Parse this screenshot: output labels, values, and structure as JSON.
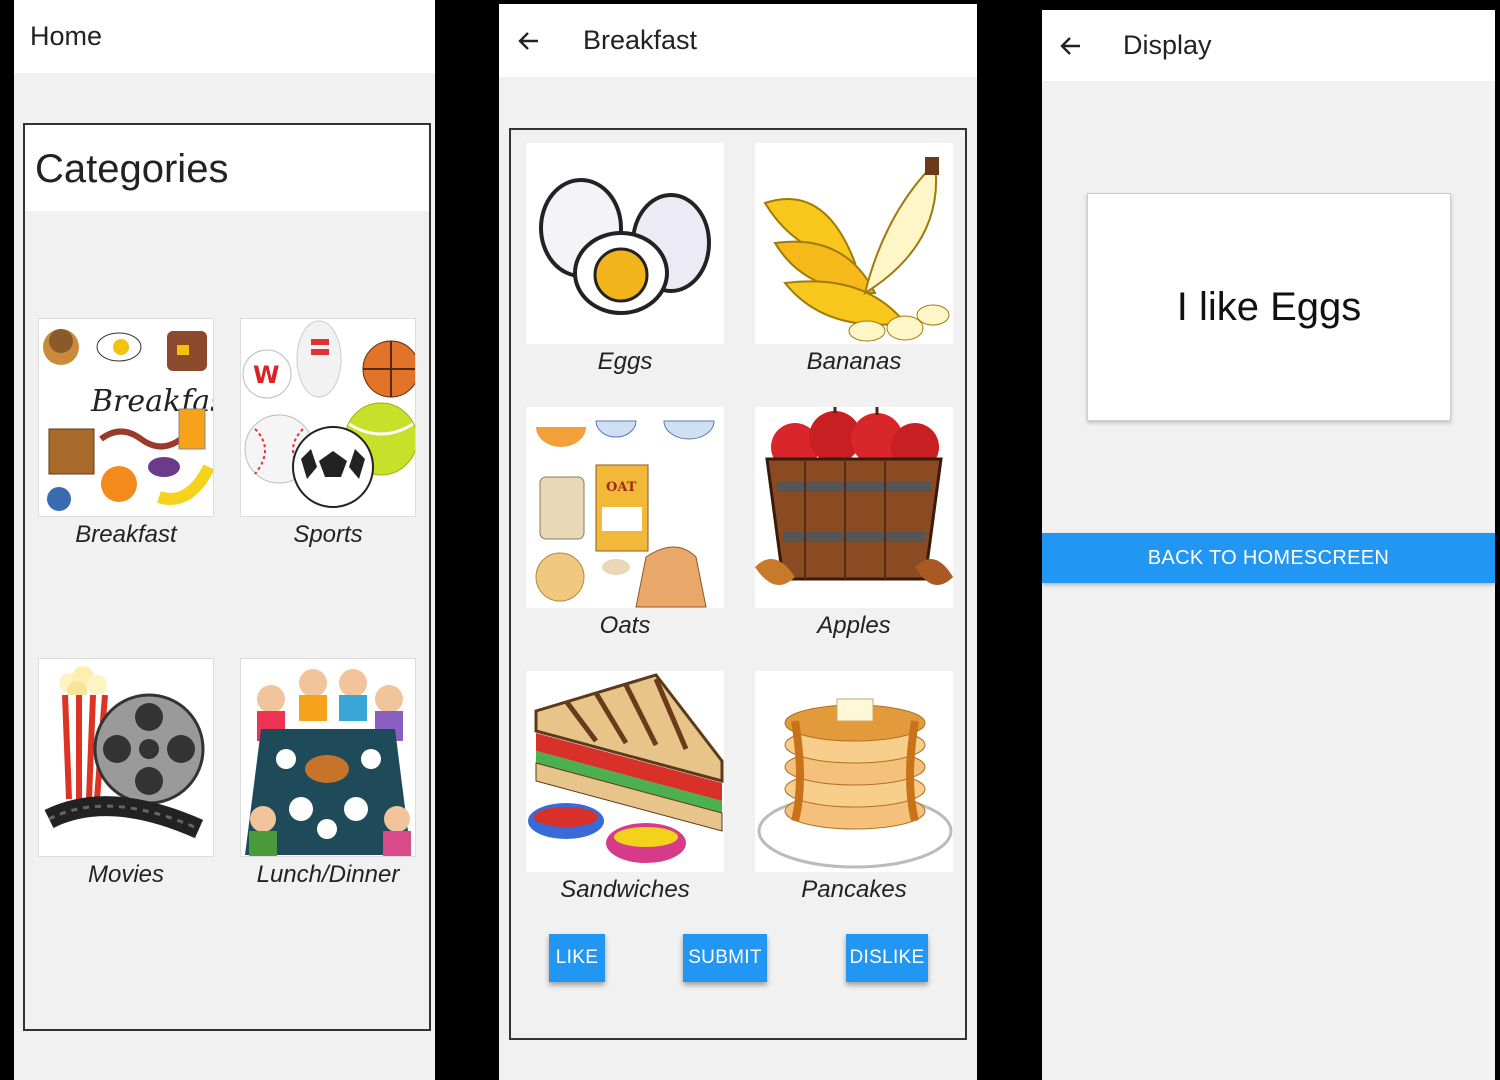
{
  "screen1": {
    "title": "Home",
    "heading": "Categories",
    "tiles": [
      {
        "label": "Breakfast",
        "icon": "breakfast-clipart-image"
      },
      {
        "label": "Sports",
        "icon": "sports-balls-image"
      },
      {
        "label": "Movies",
        "icon": "movie-reel-popcorn-image"
      },
      {
        "label": "Lunch/Dinner",
        "icon": "family-dinner-image"
      }
    ]
  },
  "screen2": {
    "title": "Breakfast",
    "items": [
      {
        "label": "Eggs",
        "icon": "eggs-image"
      },
      {
        "label": "Bananas",
        "icon": "bananas-image"
      },
      {
        "label": "Oats",
        "icon": "oats-image"
      },
      {
        "label": "Apples",
        "icon": "apples-basket-image"
      },
      {
        "label": "Sandwiches",
        "icon": "sandwich-image"
      },
      {
        "label": "Pancakes",
        "icon": "pancakes-image"
      }
    ],
    "buttons": {
      "like": "LIKE",
      "submit": "SUBMIT",
      "dislike": "DISLIKE"
    }
  },
  "screen3": {
    "title": "Display",
    "message": "I like Eggs",
    "back_button": "BACK TO HOMESCREEN"
  },
  "colors": {
    "accent": "#2196f3",
    "background": "#f1f1f1",
    "appbar": "#ffffff"
  }
}
